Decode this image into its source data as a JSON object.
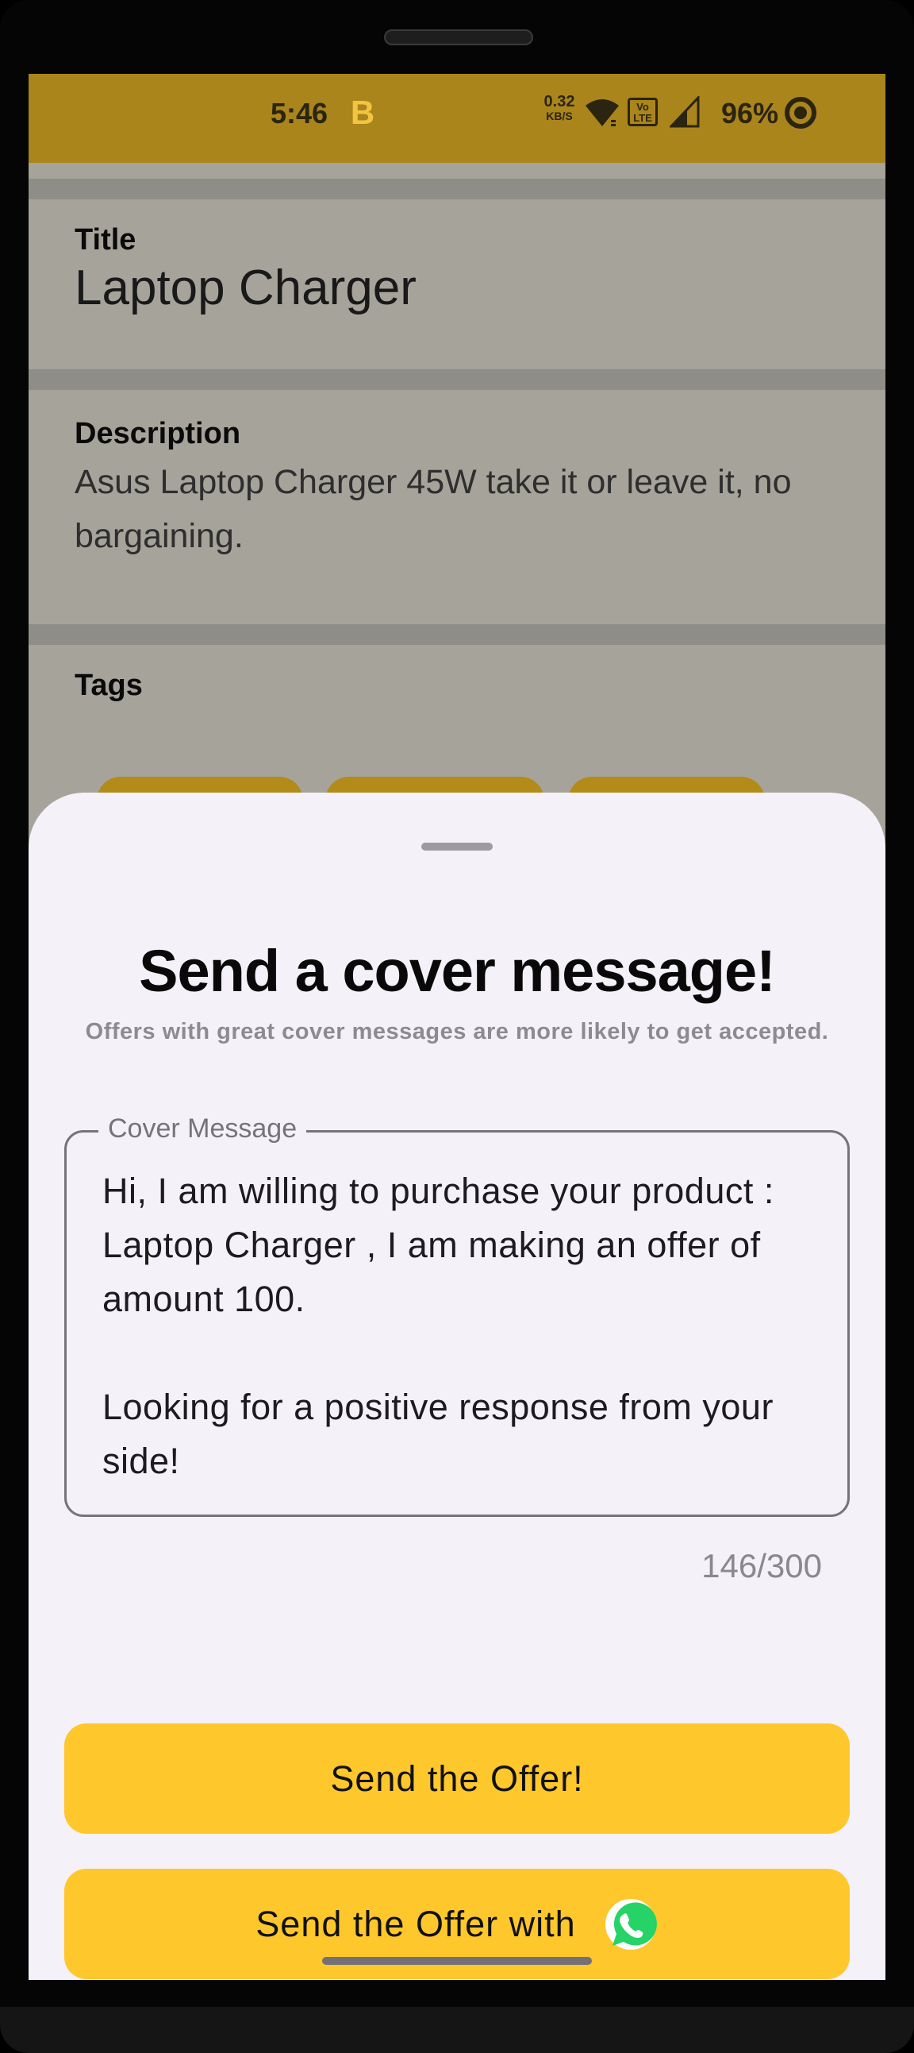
{
  "status_bar": {
    "time": "5:46",
    "app_badge": "B",
    "network_speed_value": "0.32",
    "network_speed_unit": "KB/S",
    "volte_label": "Vo LTE",
    "battery": "96%"
  },
  "listing": {
    "title_label": "Title",
    "title_value": "Laptop Charger",
    "description_label": "Description",
    "description_value": "Asus Laptop Charger 45W take it or leave it, no bargaining.",
    "tags_label": "Tags"
  },
  "sheet": {
    "title": "Send a cover message!",
    "subtitle": "Offers with great cover messages are more likely to get accepted.",
    "message_label": "Cover Message",
    "message_text": "Hi, I am willing to purchase your product : Laptop Charger , I am making an offer of amount 100.\n\nLooking for a positive response from your side!",
    "char_count": "146/300",
    "send_button": "Send the Offer!",
    "whatsapp_button": "Send the Offer with"
  },
  "colors": {
    "status_bar": "#a9851b",
    "accent": "#fec72b",
    "sheet_bg": "#f5f1f8",
    "whatsapp_green": "#25d366"
  },
  "icons": [
    "wifi-icon",
    "volte-icon",
    "signal-icon",
    "battery-ring-icon",
    "whatsapp-icon"
  ]
}
